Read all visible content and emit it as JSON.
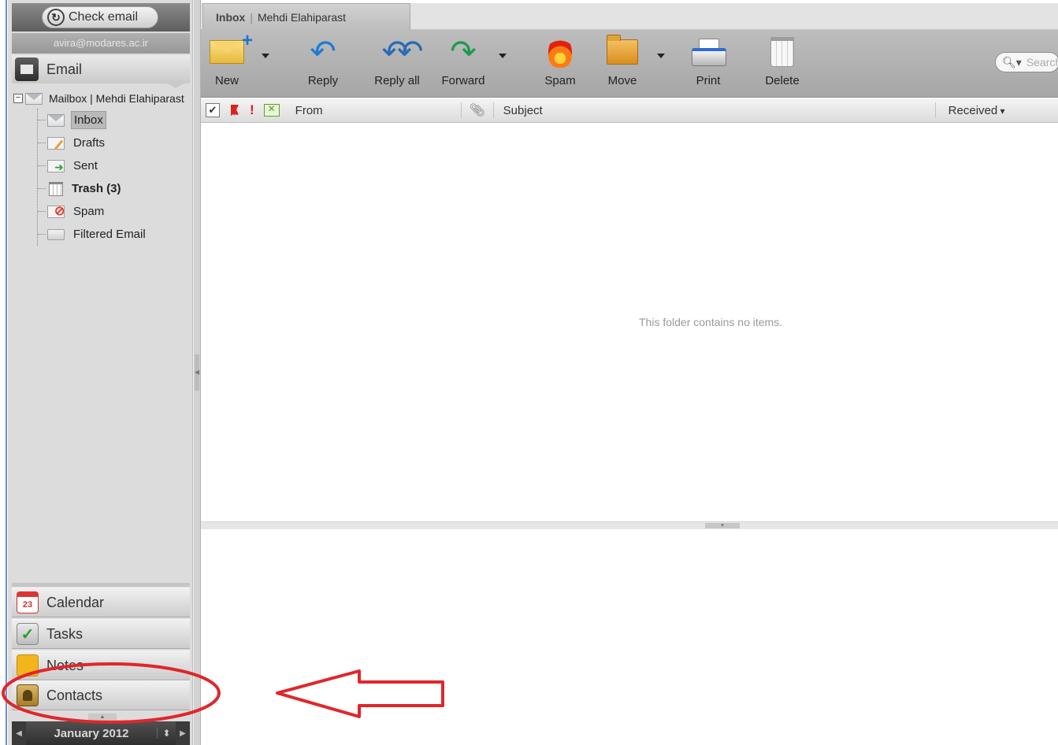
{
  "sidebar": {
    "check_email_label": "Check email",
    "account": "avira@modares.ac.ir",
    "email_label": "Email",
    "mailbox_label": "Mailbox | Mehdi Elahiparast",
    "folders": [
      {
        "label": "Inbox",
        "icon": "envelope-icon"
      },
      {
        "label": "Drafts",
        "icon": "drafts-icon"
      },
      {
        "label": "Sent",
        "icon": "sent-icon"
      },
      {
        "label": "Trash (3)",
        "icon": "trash-icon"
      },
      {
        "label": "Spam",
        "icon": "spam-icon"
      },
      {
        "label": "Filtered Email",
        "icon": "folder-icon"
      }
    ],
    "modules": [
      {
        "label": "Calendar",
        "icon": "calendar-icon",
        "icon_text": "23"
      },
      {
        "label": "Tasks",
        "icon": "tasks-icon"
      },
      {
        "label": "Notes",
        "icon": "notes-icon"
      },
      {
        "label": "Contacts",
        "icon": "contacts-icon"
      }
    ],
    "calendar_month": "January 2012"
  },
  "tab": {
    "folder": "Inbox",
    "user": "Mehdi Elahiparast"
  },
  "toolbar": {
    "new_label": "New",
    "reply_label": "Reply",
    "reply_all_label": "Reply all",
    "forward_label": "Forward",
    "spam_label": "Spam",
    "move_label": "Move",
    "print_label": "Print",
    "delete_label": "Delete",
    "search_placeholder": "Search"
  },
  "list": {
    "columns": {
      "from": "From",
      "subject": "Subject",
      "received": "Received"
    },
    "empty_message": "This folder contains no items."
  },
  "annotation": {
    "color": "#e0262b"
  },
  "colors": {
    "sidebar_bg": "#dcdcdc",
    "toolbar_bg": "#b3b3b3",
    "accent_blue": "#6d8fd0"
  }
}
